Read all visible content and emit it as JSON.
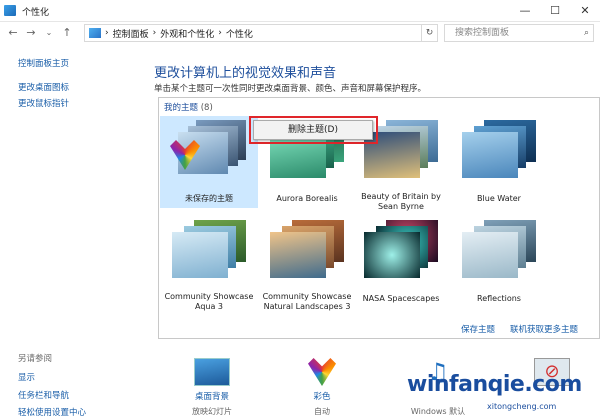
{
  "window": {
    "title": "个性化",
    "buttons": [
      "—",
      "☐",
      "✕"
    ]
  },
  "nav": {
    "breadcrumb": [
      "控制面板",
      "›",
      "外观和个性化",
      "›",
      "个性化"
    ],
    "search_placeholder": "搜索控制面板"
  },
  "sidebar": {
    "links": [
      "控制面板主页",
      "更改桌面图标",
      "更改鼠标指针"
    ],
    "see_also_heading": "另请参阅",
    "see_also": [
      "显示",
      "任务栏和导航",
      "轻松使用设置中心"
    ]
  },
  "main": {
    "title": "更改计算机上的视觉效果和声音",
    "description": "单击某个主题可一次性同时更改桌面背景、颜色、声音和屏幕保护程序。"
  },
  "themes": {
    "group_label": "我的主题",
    "group_count": "(8)",
    "items": [
      {
        "caption": "未保存的主题",
        "selected": true
      },
      {
        "caption": "Aurora Borealis"
      },
      {
        "caption": "Beauty of Britain by Sean Byrne"
      },
      {
        "caption": "Blue Water"
      },
      {
        "caption": "Community Showcase Aqua 3"
      },
      {
        "caption": "Community Showcase Natural Landscapes 3"
      },
      {
        "caption": "NASA Spacescapes"
      },
      {
        "caption": "Reflections"
      }
    ],
    "save_link": "保存主题",
    "online_link": "联机获取更多主题"
  },
  "context_menu": {
    "item": "删除主题(D)"
  },
  "bottom_bar": {
    "items": [
      {
        "label": "桌面背景",
        "sub": "放映幻灯片"
      },
      {
        "label": "彩色",
        "sub": "自动"
      },
      {
        "label": "",
        "sub": "Windows 默认"
      }
    ]
  },
  "watermark": {
    "main": "winfanqie.com",
    "sub": "xitongcheng.com"
  },
  "colors": {
    "link": "#1a5ea8",
    "heading": "#1e4f9c",
    "selection": "#cde8ff",
    "highlight_border": "#e0262b"
  }
}
